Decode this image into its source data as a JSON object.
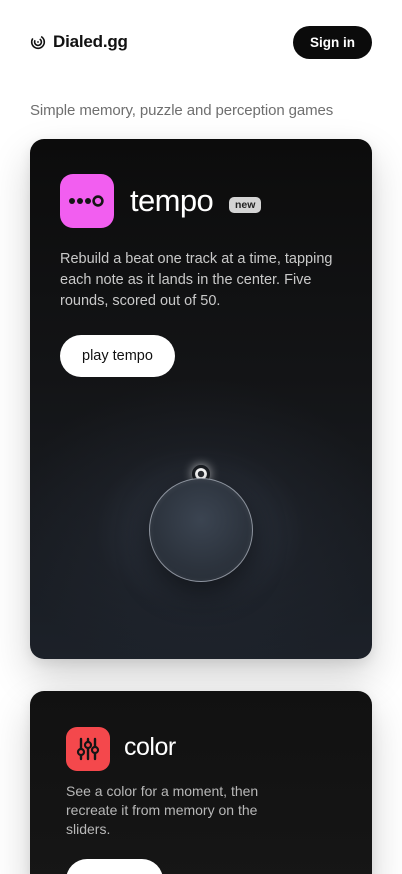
{
  "header": {
    "brand_name": "Dialed.gg",
    "sign_in_label": "Sign in"
  },
  "tagline": "Simple memory, puzzle and perception games",
  "games": {
    "tempo": {
      "title": "tempo",
      "badge": "new",
      "description": "Rebuild a beat one track at a time, tapping each note as it lands in the center. Five rounds, scored out of 50.",
      "play_label": "play tempo",
      "icon_name": "tempo-dots-icon",
      "icon_color": "#f25ef0"
    },
    "color": {
      "title": "color",
      "description": "See a color for a moment, then recreate it from memory on the sliders.",
      "icon_name": "sliders-icon",
      "icon_color": "#f4484c"
    }
  }
}
